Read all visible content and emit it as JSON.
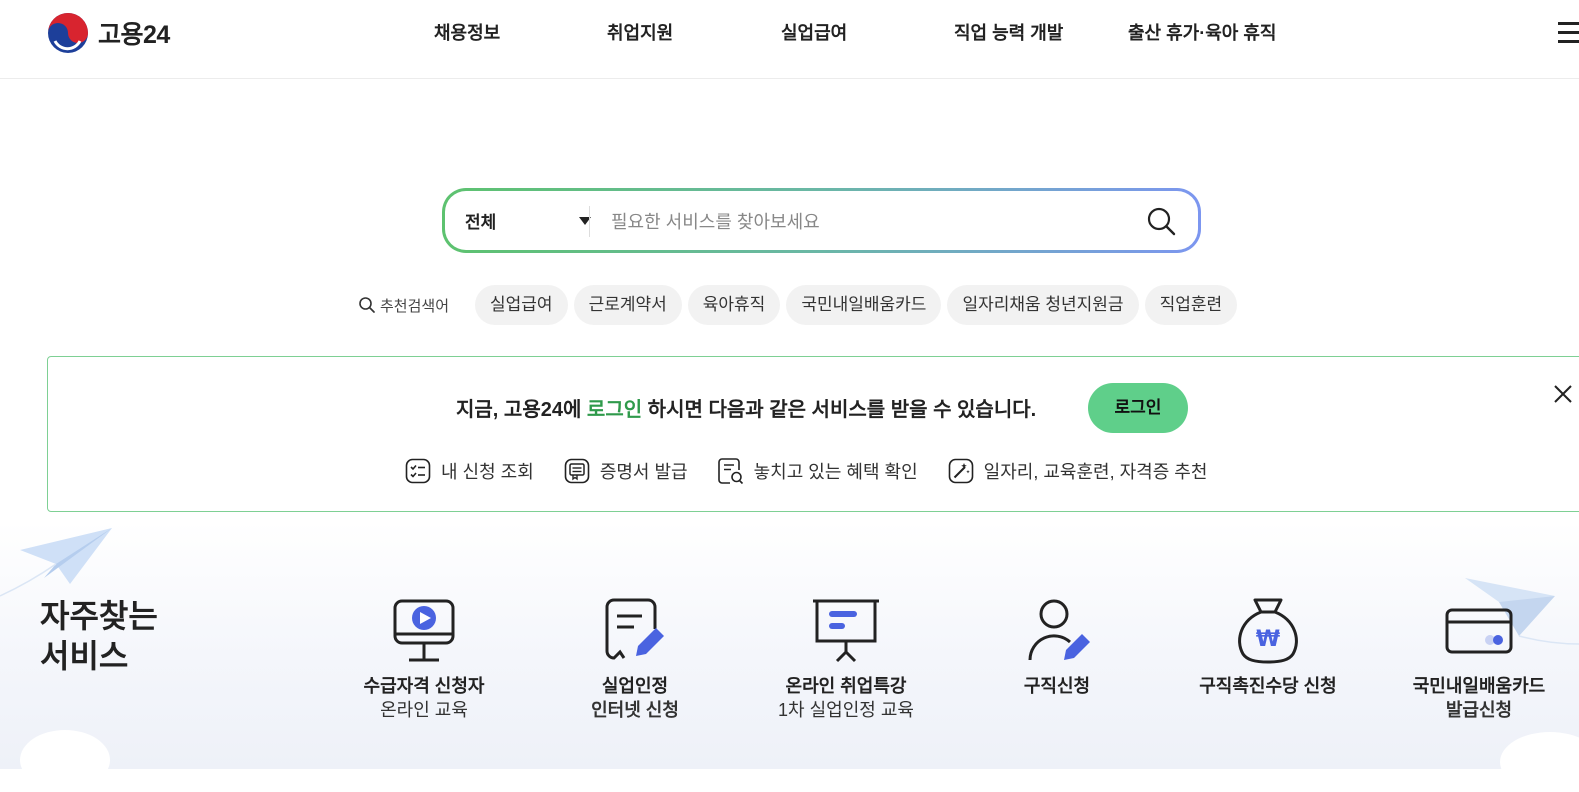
{
  "header": {
    "logo_text": "고용24",
    "nav": [
      "채용정보",
      "취업지원",
      "실업급여",
      "직업 능력 개발",
      "출산 휴가·육아 휴직"
    ]
  },
  "search": {
    "category": "전체",
    "placeholder": "필요한 서비스를 찾아보세요"
  },
  "keywords": {
    "label": "추천검색어",
    "items": [
      "실업급여",
      "근로계약서",
      "육아휴직",
      "국민내일배움카드",
      "일자리채움 청년지원금",
      "직업훈련"
    ]
  },
  "login_banner": {
    "msg_before": "지금, 고용24에 ",
    "msg_highlight": "로그인",
    "msg_after": " 하시면 다음과 같은 서비스를 받을 수 있습니다.",
    "button": "로그인",
    "benefits": [
      "내 신청 조회",
      "증명서 발급",
      "놓치고 있는 혜택 확인",
      "일자리, 교육훈련, 자격증 추천"
    ]
  },
  "frequent": {
    "title_line1": "자주찾는",
    "title_line2": "서비스",
    "items": [
      {
        "line1": "수급자격 신청자",
        "line2": "온라인 교육",
        "icon": "monitor-play-icon"
      },
      {
        "line1": "실업인정",
        "line2": "인터넷 신청",
        "icon": "document-pen-icon"
      },
      {
        "line1": "온라인 취업특강",
        "line2": "1차 실업인정 교육",
        "icon": "presentation-board-icon"
      },
      {
        "line1": "구직신청",
        "line2": "",
        "icon": "person-pen-icon"
      },
      {
        "line1": "구직촉진수당 신청",
        "line2": "",
        "icon": "money-bag-icon"
      },
      {
        "line1": "국민내일배움카드",
        "line2": "발급신청",
        "icon": "credit-card-icon"
      }
    ]
  },
  "colors": {
    "accent_green": "#2f9a4b",
    "login_button": "#5fcf8a",
    "icon_blue": "#4a63e0"
  }
}
